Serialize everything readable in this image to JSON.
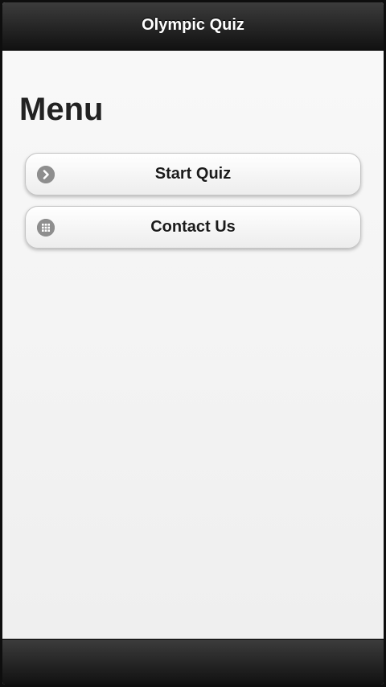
{
  "header": {
    "title": "Olympic Quiz"
  },
  "main": {
    "heading": "Menu",
    "buttons": [
      {
        "label": "Start Quiz",
        "icon": "arrow-right-circle-icon"
      },
      {
        "label": "Contact Us",
        "icon": "grid-icon"
      }
    ]
  },
  "colors": {
    "bar": "#1f1f1f",
    "background": "#f3f3f3",
    "icon": "#8e8e8e"
  }
}
